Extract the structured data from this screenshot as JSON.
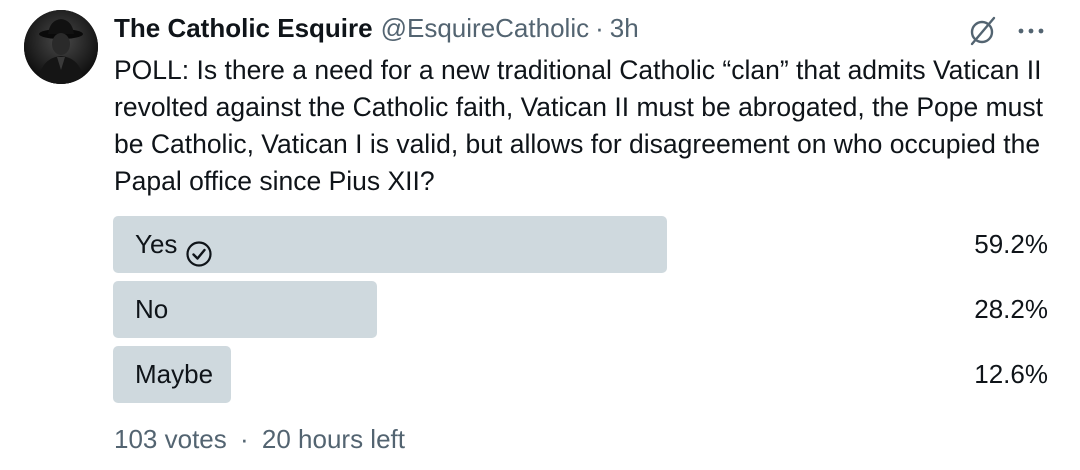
{
  "author": {
    "display_name": "The Catholic Esquire",
    "handle": "@EsquireCatholic",
    "separator": "·",
    "timestamp": "3h",
    "avatar_icon": "hooded-figure-avatar"
  },
  "actions": {
    "grok_icon": "grok-slash-circle-icon",
    "more_icon": "more-horizontal-icon"
  },
  "tweet": {
    "text": "POLL: Is there a need for a new traditional Catholic “clan” that admits Vatican II revolted against the Catholic faith, Vatican II must be abrogated, the Pope must be Catholic, Vatican I is valid, but allows for disagreement on who occupied the Papal office since Pius XII?"
  },
  "poll": {
    "options": [
      {
        "label": "Yes",
        "percent_text": "59.2%",
        "fraction": 0.592,
        "selected": true
      },
      {
        "label": "No",
        "percent_text": "28.2%",
        "fraction": 0.282,
        "selected": false
      },
      {
        "label": "Maybe",
        "percent_text": "12.6%",
        "fraction": 0.126,
        "selected": false
      }
    ],
    "votes": "103 votes",
    "separator": "·",
    "time_left": "20 hours left"
  },
  "colors": {
    "bar": "#cfd9de",
    "secondary_text": "#536471",
    "primary_text": "#0f1419"
  }
}
